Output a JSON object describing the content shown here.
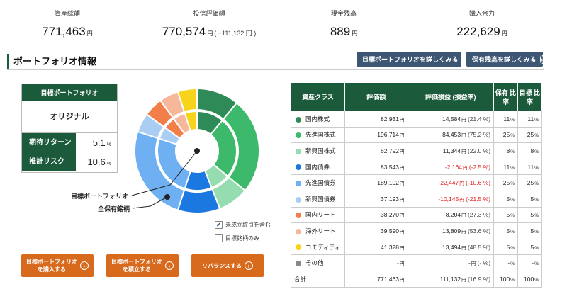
{
  "summary": [
    {
      "label": "資産総額",
      "value": "771,463",
      "unit": "円",
      "change": ""
    },
    {
      "label": "投信評価額",
      "value": "770,574",
      "unit": "円",
      "change": "( +111,132 円 )"
    },
    {
      "label": "現金残高",
      "value": "889",
      "unit": "円",
      "change": ""
    },
    {
      "label": "購入余力",
      "value": "222,629",
      "unit": "円",
      "change": ""
    }
  ],
  "section_title": "ポートフォリオ情報",
  "nav_buttons": {
    "target_detail": "目標ポートフォリオを詳しくみる",
    "holdings_detail": "保有残高を詳しくみる",
    "arrow": "›"
  },
  "target_box": {
    "header": "目標ポートフォリオ",
    "name": "オリジナル",
    "rows": [
      {
        "label": "期待リターン",
        "value": "5.1",
        "unit": "%"
      },
      {
        "label": "推計リスク",
        "value": "10.6",
        "unit": "%"
      }
    ]
  },
  "chart_labels": {
    "inner": "目標ポートフォリオ",
    "outer": "全保有銘柄"
  },
  "checkboxes": {
    "include_unsettled": {
      "label": "未成立取引を含む",
      "checked": true
    },
    "target_only": {
      "label": "目標銘柄のみ",
      "checked": false
    }
  },
  "action_buttons": {
    "buy_line1": "目標ポートフォリオ",
    "buy_line2": "を購入する",
    "save_line1": "目標ポートフォリオ",
    "save_line2": "を積立する",
    "rebalance": "リバランスする"
  },
  "colors": {
    "brand_green": "#1c5a3c",
    "nav_blue": "#3d5673",
    "action_orange": "#d86a1e",
    "negative": "#e02020"
  },
  "table": {
    "headers": {
      "class": "資産クラス",
      "value": "評価額",
      "pl": "評価損益 (損益率)",
      "hold_ratio": "保有 比率",
      "target_ratio": "目標 比率"
    },
    "rows": [
      {
        "name": "国内株式",
        "color": "#2e8b57",
        "value": "82,931",
        "pl": "14,584",
        "pl_rate": "(21.4 %)",
        "hold": "11",
        "target": "11",
        "negative": false
      },
      {
        "name": "先進国株式",
        "color": "#3cb96a",
        "value": "196,714",
        "pl": "84,453",
        "pl_rate": "(75.2 %)",
        "hold": "25",
        "target": "25",
        "negative": false
      },
      {
        "name": "新興国株式",
        "color": "#95dcb0",
        "value": "62,792",
        "pl": "11,344",
        "pl_rate": "(22.0 %)",
        "hold": "8",
        "target": "8",
        "negative": false
      },
      {
        "name": "国内債券",
        "color": "#1a78e0",
        "value": "83,543",
        "pl": "-2,164",
        "pl_rate": "(-2.5 %)",
        "hold": "11",
        "target": "11",
        "negative": true
      },
      {
        "name": "先進国債券",
        "color": "#6eb0f2",
        "value": "189,102",
        "pl": "-22,447",
        "pl_rate": "(-10.6 %)",
        "hold": "25",
        "target": "25",
        "negative": true
      },
      {
        "name": "新興国債券",
        "color": "#aacdf3",
        "value": "37,193",
        "pl": "-10,145",
        "pl_rate": "(-21.5 %)",
        "hold": "5",
        "target": "5",
        "negative": true
      },
      {
        "name": "国内リート",
        "color": "#f27f4a",
        "value": "38,270",
        "pl": "8,204",
        "pl_rate": "(27.3 %)",
        "hold": "5",
        "target": "5",
        "negative": false
      },
      {
        "name": "海外リート",
        "color": "#f6b79a",
        "value": "39,590",
        "pl": "13,809",
        "pl_rate": "(53.6 %)",
        "hold": "5",
        "target": "5",
        "negative": false
      },
      {
        "name": "コモディティ",
        "color": "#f7d31a",
        "value": "41,328",
        "pl": "13,494",
        "pl_rate": "(48.5 %)",
        "hold": "5",
        "target": "5",
        "negative": false
      },
      {
        "name": "その他",
        "color": "#888888",
        "value": "-",
        "pl": "-",
        "pl_rate": "(- %)",
        "hold": "-",
        "target": "-",
        "negative": false
      }
    ],
    "total": {
      "name": "合計",
      "value": "771,463",
      "pl": "111,132",
      "pl_rate": "(16.9 %)",
      "hold": "100",
      "target": "100"
    },
    "yen": "円",
    "pct": "%"
  }
}
